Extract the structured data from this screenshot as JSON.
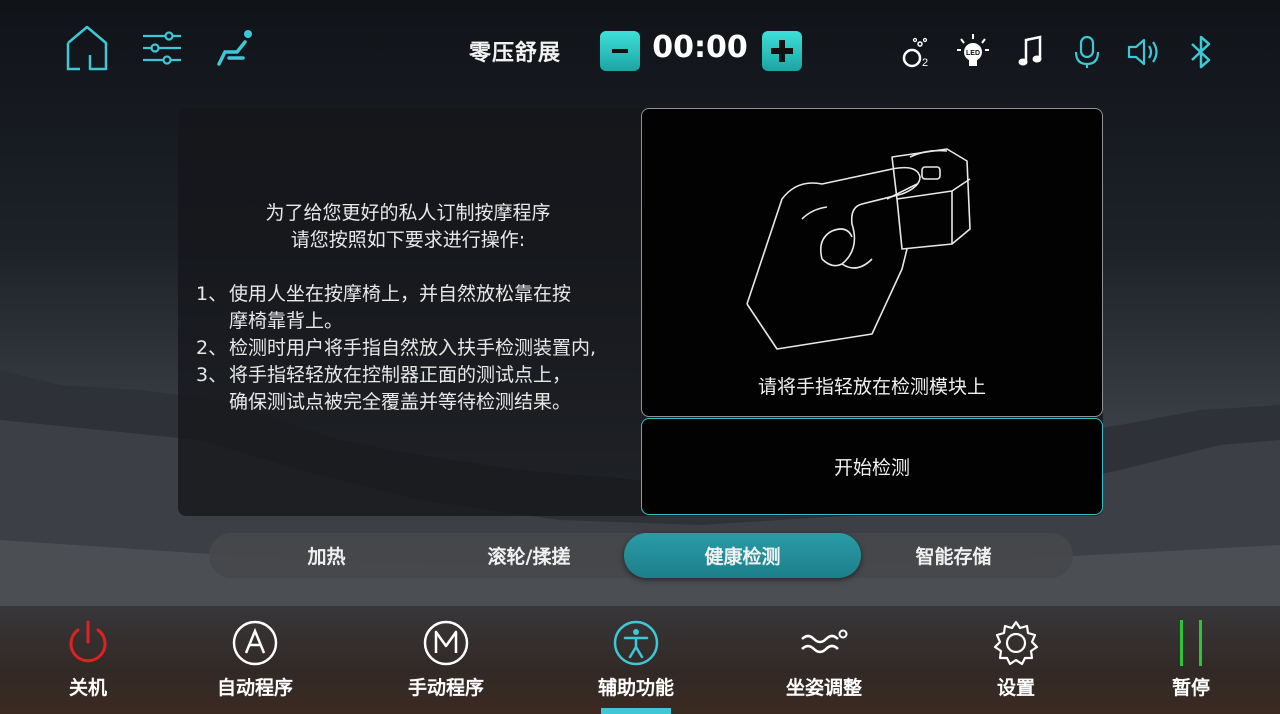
{
  "header": {
    "mode_title": "零压舒展",
    "timer": "00:00",
    "left_icons": [
      "home-icon",
      "sliders-icon",
      "chair-massage-icon"
    ],
    "status_icons": [
      "oxygen-icon",
      "led-icon",
      "music-icon",
      "microphone-icon",
      "speaker-icon",
      "bluetooth-icon"
    ]
  },
  "main": {
    "intro_line1": "为了给您更好的私人订制按摩程序",
    "intro_line2": "请您按照如下要求进行操作:",
    "steps": [
      {
        "num": "1、",
        "lines": [
          "使用人坐在按摩椅上，并自然放松靠在按",
          "摩椅靠背上。"
        ]
      },
      {
        "num": "2、",
        "lines": [
          "检测时用户将手指自然放入扶手检测装置内,"
        ]
      },
      {
        "num": "3、",
        "lines": [
          "将手指轻轻放在控制器正面的测试点上，",
          "确保测试点被完全覆盖并等待检测结果。"
        ]
      }
    ],
    "image_caption": "请将手指轻放在检测模块上",
    "start_button": "开始检测"
  },
  "subtabs": [
    {
      "label": "加热",
      "active": false
    },
    {
      "label": "滚轮/揉搓",
      "active": false
    },
    {
      "label": "健康检测",
      "active": true
    },
    {
      "label": "智能存储",
      "active": false
    }
  ],
  "bottom_nav": [
    {
      "label": "关机",
      "icon": "power-icon"
    },
    {
      "label": "自动程序",
      "icon": "auto-a-icon"
    },
    {
      "label": "手动程序",
      "icon": "manual-m-icon"
    },
    {
      "label": "辅助功能",
      "icon": "accessibility-icon",
      "active": true
    },
    {
      "label": "坐姿调整",
      "icon": "posture-wave-icon"
    },
    {
      "label": "设置",
      "icon": "gear-icon"
    },
    {
      "label": "暂停",
      "icon": "pause-icon"
    }
  ],
  "colors": {
    "accent": "#3ec7d6",
    "power": "#e0211f",
    "pause": "#2ec43a",
    "active_tab": "#1f8e99"
  }
}
